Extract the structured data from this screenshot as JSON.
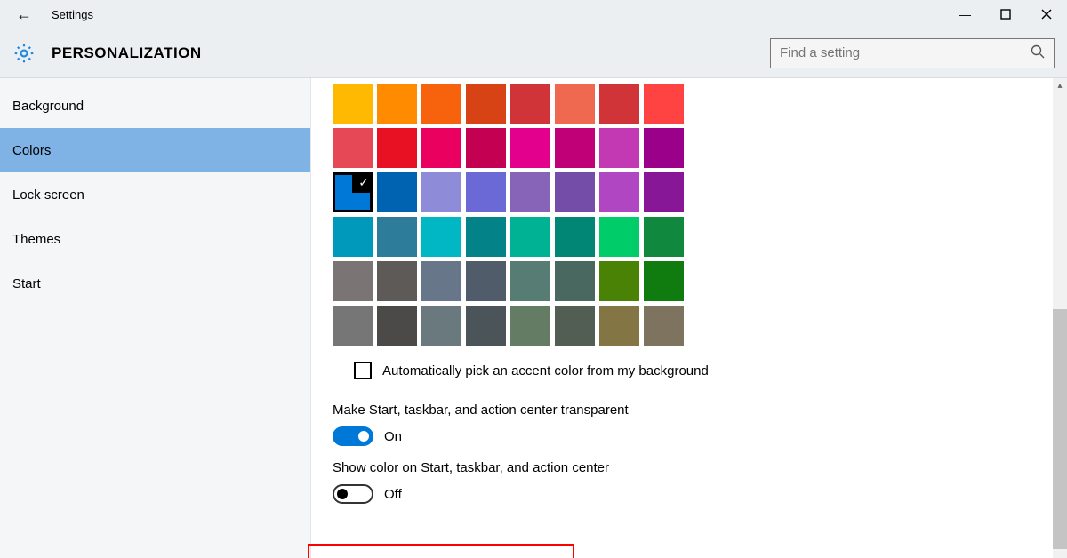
{
  "titlebar": {
    "title": "Settings"
  },
  "header": {
    "page_title": "PERSONALIZATION",
    "search_placeholder": "Find a setting"
  },
  "sidebar": {
    "items": [
      {
        "label": "Background",
        "selected": false
      },
      {
        "label": "Colors",
        "selected": true
      },
      {
        "label": "Lock screen",
        "selected": false
      },
      {
        "label": "Themes",
        "selected": false
      },
      {
        "label": "Start",
        "selected": false
      }
    ]
  },
  "colors": {
    "swatches": [
      [
        "#ffb900",
        "#ff8c00",
        "#f7630c",
        "#d84315",
        "#d13438",
        "#ef6950",
        "#d03438",
        "#ff4343"
      ],
      [
        "#e74856",
        "#e81123",
        "#ea005e",
        "#c30052",
        "#e3008c",
        "#bf0077",
        "#c239b3",
        "#9a0089"
      ],
      [
        "#0078d7",
        "#0063b1",
        "#8e8cd8",
        "#6b69d6",
        "#8764b8",
        "#744da9",
        "#b146c2",
        "#881798"
      ],
      [
        "#0099bc",
        "#2d7d9a",
        "#00b7c3",
        "#038387",
        "#00b294",
        "#018574",
        "#00cc6a",
        "#10893e"
      ],
      [
        "#7a7574",
        "#5d5a58",
        "#68768a",
        "#515c6b",
        "#567c73",
        "#486860",
        "#498205",
        "#107c10"
      ],
      [
        "#767676",
        "#4c4a48",
        "#69797e",
        "#4a5459",
        "#647c64",
        "#525e54",
        "#847545",
        "#7e735f"
      ]
    ],
    "selected_row": 2,
    "selected_col": 0,
    "auto_pick_label": "Automatically pick an accent color from my background",
    "auto_pick_checked": false
  },
  "settings": {
    "transparent": {
      "label": "Make Start, taskbar, and action center transparent",
      "state": "On",
      "on": true
    },
    "show_color": {
      "label": "Show color on Start, taskbar, and action center",
      "state": "Off",
      "on": false
    }
  }
}
